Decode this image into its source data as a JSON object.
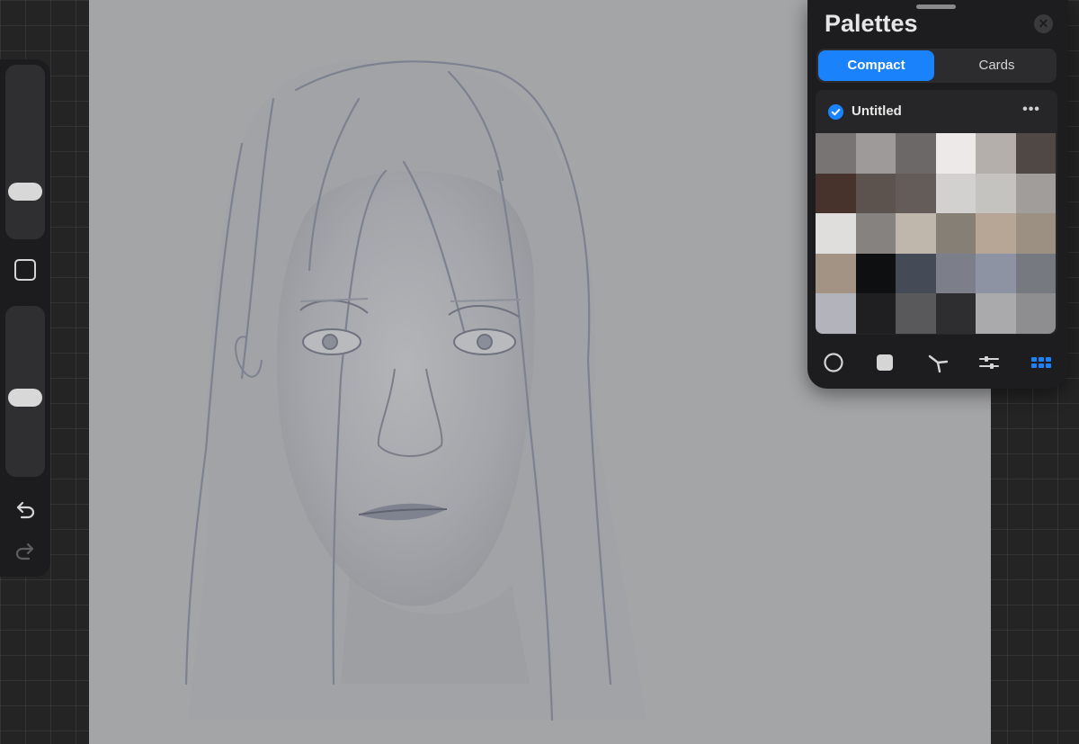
{
  "palettes_panel": {
    "title": "Palettes",
    "tabs": [
      {
        "label": "Compact",
        "active": true
      },
      {
        "label": "Cards",
        "active": false
      }
    ],
    "palette": {
      "name": "Untitled",
      "selected": true,
      "swatches": [
        "#787474",
        "#9e9a9a",
        "#6c6868",
        "#ede9e9",
        "#b4afaa",
        "#4f4845",
        "#47322c",
        "#5c534f",
        "#645c58",
        "#d3d1cf",
        "#c5c3c0",
        "#a09d9b",
        "#e0dedc",
        "#868280",
        "#c0b7ac",
        "#857f75",
        "#b7a696",
        "#9c9083",
        "#a39384",
        "#0e0f11",
        "#444a56",
        "#7c7f8a",
        "#8e93a4",
        "#777981",
        "#b3b3bb",
        "#1f1f22",
        "#59595c",
        "#2e2e31",
        "#aaaaad",
        "#8e8e90"
      ]
    },
    "toolbar_icons": [
      "disc-icon",
      "classic-icon",
      "harmony-icon",
      "value-icon",
      "palettes-icon"
    ],
    "accent": "#1a82fb"
  },
  "sidebar": {
    "brush_size_level": 0.27,
    "opacity_level": 0.54,
    "icons": [
      "modify-square-icon",
      "undo-icon",
      "redo-icon"
    ]
  }
}
